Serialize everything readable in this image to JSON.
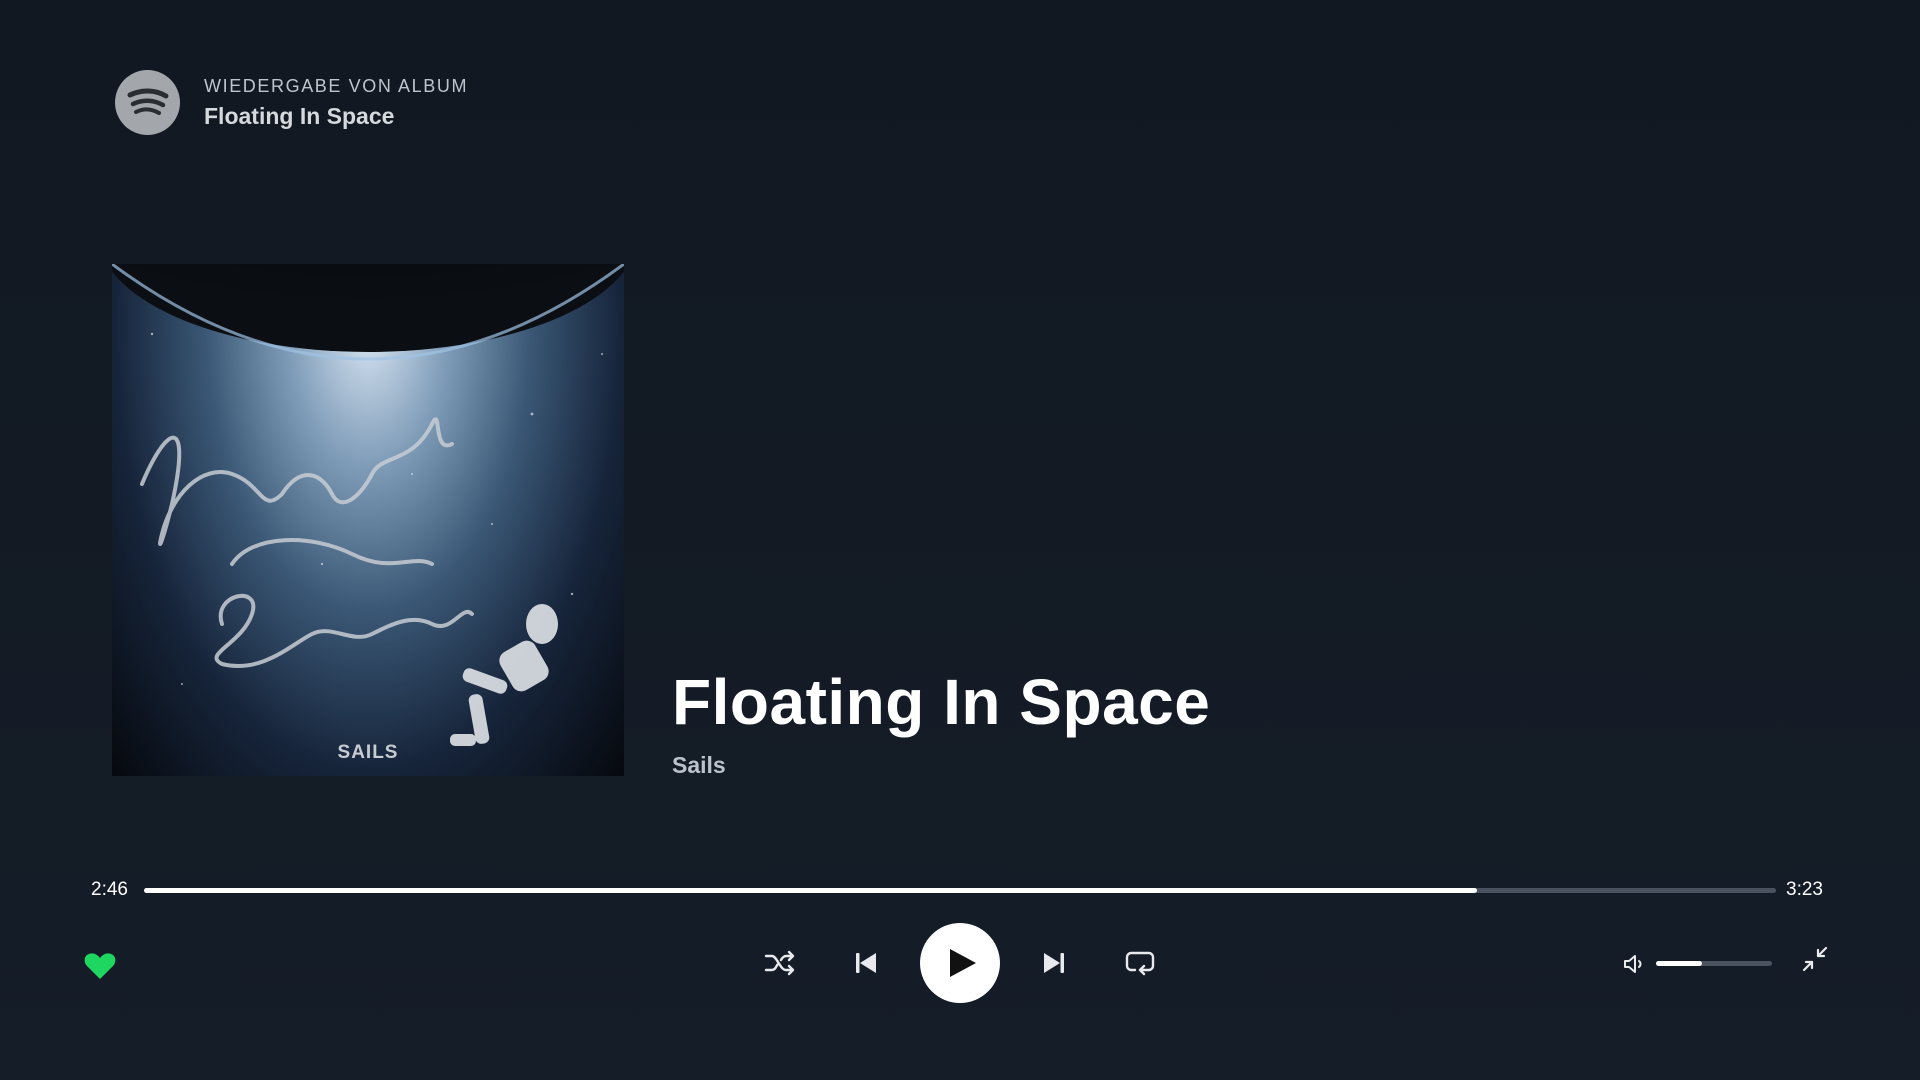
{
  "header": {
    "context_type": "WIEDERGABE VON ALBUM",
    "context_name": "Floating In Space"
  },
  "album_art": {
    "text": "SAILS"
  },
  "track": {
    "title": "Floating In Space",
    "artist": "Sails"
  },
  "progress": {
    "elapsed": "2:46",
    "total": "3:23",
    "fraction": 0.817
  },
  "volume": {
    "fraction": 0.4
  },
  "controls": {
    "liked": true,
    "icons": [
      "heart-icon",
      "shuffle-icon",
      "previous-icon",
      "play-icon",
      "next-icon",
      "repeat-icon",
      "volume-icon",
      "minimize-icon"
    ]
  },
  "colors": {
    "background": "#121a24",
    "accent": "#1ed760",
    "progress_fill": "#ffffff",
    "progress_track": "#4a5260"
  }
}
